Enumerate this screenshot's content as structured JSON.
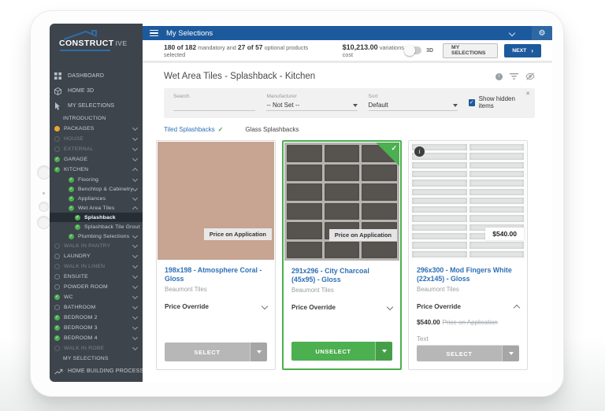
{
  "app_bar": {
    "title": "My Selections"
  },
  "logo": {
    "part1": "CONSTRUCT",
    "part2": "IVE"
  },
  "summary_bar": {
    "mandatory_count": "180 of 182",
    "mandatory_text": "mandatory and",
    "optional_count": "27 of 57",
    "optional_text": "optional products selected",
    "cost": "$10,213.00",
    "cost_label": "variations cost",
    "toggle_label": "3D",
    "my_selections_button": "MY SELECTIONS",
    "next_button": "NEXT"
  },
  "sidebar": {
    "items": [
      {
        "label": "DASHBOARD",
        "icon": "dashboard",
        "indent": 0,
        "status": "none",
        "chevron": "none"
      },
      {
        "label": "HOME 3D",
        "icon": "home3d",
        "indent": 0,
        "status": "none",
        "chevron": "none"
      },
      {
        "label": "MY SELECTIONS",
        "icon": "selections",
        "indent": 0,
        "status": "none",
        "chevron": "none"
      },
      {
        "label": "INTRODUCTION",
        "indent": 1,
        "status": "none",
        "chevron": "none"
      },
      {
        "label": "PACKAGES",
        "indent": 0,
        "status": "orange",
        "chevron": "down"
      },
      {
        "label": "HOUSE",
        "indent": 0,
        "status": "gray",
        "chevron": "down",
        "dim": true
      },
      {
        "label": "EXTERNAL",
        "indent": 0,
        "status": "gray",
        "chevron": "down",
        "dim": true
      },
      {
        "label": "GARAGE",
        "indent": 0,
        "status": "check",
        "chevron": "down"
      },
      {
        "label": "KITCHEN",
        "indent": 0,
        "status": "check",
        "chevron": "up"
      },
      {
        "label": "Flooring",
        "indent": 2,
        "status": "check",
        "chevron": "down"
      },
      {
        "label": "Benchtop & Cabinetry",
        "indent": 2,
        "status": "check",
        "chevron": "down"
      },
      {
        "label": "Appliances",
        "indent": 2,
        "status": "check",
        "chevron": "down"
      },
      {
        "label": "Wet Area Tiles",
        "indent": 2,
        "status": "check",
        "chevron": "up"
      },
      {
        "label": "Splashback",
        "indent": 3,
        "status": "check",
        "chevron": "none",
        "active": true
      },
      {
        "label": "Splashback Tile Grout",
        "indent": 3,
        "status": "check",
        "chevron": "none"
      },
      {
        "label": "Plumbing Selections",
        "indent": 2,
        "status": "check",
        "chevron": "down"
      },
      {
        "label": "WALK IN PANTRY",
        "indent": 0,
        "status": "gray",
        "chevron": "down",
        "dim": true
      },
      {
        "label": "LAUNDRY",
        "indent": 0,
        "status": "gray",
        "chevron": "down"
      },
      {
        "label": "WALK IN LINEN",
        "indent": 0,
        "status": "gray",
        "chevron": "down",
        "dim": true
      },
      {
        "label": "ENSUITE",
        "indent": 0,
        "status": "gray",
        "chevron": "down"
      },
      {
        "label": "POWDER ROOM",
        "indent": 0,
        "status": "gray",
        "chevron": "down"
      },
      {
        "label": "WC",
        "indent": 0,
        "status": "check",
        "chevron": "down"
      },
      {
        "label": "BATHROOM",
        "indent": 0,
        "status": "gray",
        "chevron": "down"
      },
      {
        "label": "BEDROOM 2",
        "indent": 0,
        "status": "check",
        "chevron": "down"
      },
      {
        "label": "BEDROOM 3",
        "indent": 0,
        "status": "check",
        "chevron": "down"
      },
      {
        "label": "BEDROOM 4",
        "indent": 0,
        "status": "check",
        "chevron": "down"
      },
      {
        "label": "WALK IN ROBE",
        "indent": 0,
        "status": "gray",
        "chevron": "down",
        "dim": true
      },
      {
        "label": "MY SELECTIONS",
        "indent": 1,
        "status": "none",
        "chevron": "none"
      },
      {
        "label": "HOME BUILDING PROCESS",
        "icon": "chart",
        "indent": 0,
        "status": "none",
        "chevron": "none"
      }
    ]
  },
  "page": {
    "title": "Wet Area Tiles - Splashback - Kitchen"
  },
  "filter_bar": {
    "search_label": "Search",
    "manufacturer_label": "Manufacturer",
    "manufacturer_value": "-- Not Set --",
    "sort_label": "Sort",
    "sort_value": "Default",
    "show_hidden_label": "Show hidden items",
    "show_hidden_checked": true,
    "check_glyph": "✓"
  },
  "tabs": [
    {
      "label": "Tiled Splashbacks",
      "active": true,
      "check": "✓"
    },
    {
      "label": "Glass Splashbacks",
      "active": false
    }
  ],
  "products": [
    {
      "title": "198x198 - Atmosphere Coral - Gloss",
      "brand": "Beaumont Tiles",
      "image_badge": "Price on Application",
      "override_label": "Price Override",
      "button_label": "SELECT",
      "selected": false,
      "tile": {
        "pattern": "solid",
        "color": "#c8a492"
      }
    },
    {
      "title": "291x296 - City Charcoal (45x95) - Gloss",
      "brand": "Beaumont Tiles",
      "image_badge": "Price on Application",
      "override_label": "Price Override",
      "button_label": "UNSELECT",
      "selected": true,
      "check_glyph": "✓",
      "tile": {
        "pattern": "grid",
        "cols": 3,
        "rows": 6,
        "cell_color": "#57544f",
        "grout_color": "#b5b4b0"
      }
    },
    {
      "title": "296x300 - Mod Fingers White (22x145) - Gloss",
      "brand": "Beaumont Tiles",
      "image_badge": "$540.00",
      "override_label": "Price Override",
      "override_price": "$540.00",
      "override_strike": "Price on Application",
      "override_placeholder": "Text",
      "button_label": "SELECT",
      "selected": false,
      "info_glyph": "i",
      "tile": {
        "pattern": "grid",
        "cols": 2,
        "rows": 13,
        "cell_color": "#e3e5e5",
        "grout_color": "#fbfbfb"
      }
    }
  ],
  "colors": {
    "accent_blue": "#1d5a9d",
    "link_blue": "#2e6fb7",
    "success_green": "#4caf50",
    "pending_orange": "#eda52f"
  }
}
